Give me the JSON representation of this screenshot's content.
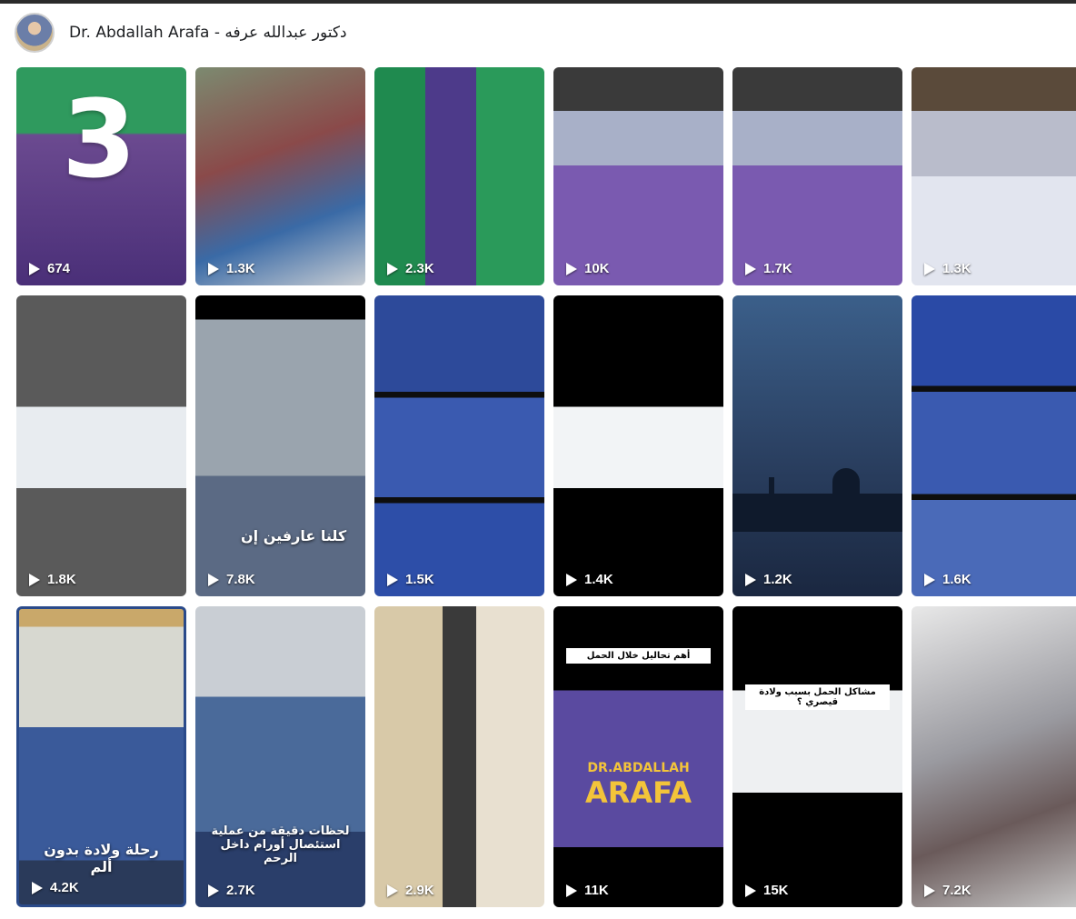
{
  "page": {
    "title": "Dr. Abdallah Arafa - دكتور عبدالله عرفه"
  },
  "icons": {
    "play": "play-icon",
    "avatar": "avatar"
  },
  "videos": [
    {
      "views": "674",
      "overlay": "3"
    },
    {
      "views": "1.3K"
    },
    {
      "views": "2.3K"
    },
    {
      "views": "10K"
    },
    {
      "views": "1.7K"
    },
    {
      "views": "1.3K"
    },
    {
      "views": "1.8K"
    },
    {
      "views": "7.8K",
      "overlay": "كلنا عارفين إن"
    },
    {
      "views": "1.5K"
    },
    {
      "views": "1.4K"
    },
    {
      "views": "1.2K"
    },
    {
      "views": "1.6K"
    },
    {
      "views": "4.2K",
      "overlay": "رحلة ولادة بدون ألم"
    },
    {
      "views": "2.7K",
      "overlay": "لحظات دقيقة من عملية استئصال أورام داخل الرحم"
    },
    {
      "views": "2.9K"
    },
    {
      "views": "11K",
      "label": "أهم تحاليل خلال الحمل",
      "brand_small": "DR.ABDALLAH",
      "brand_big": "ARAFA"
    },
    {
      "views": "15K",
      "label": "مشاكل الحمل بسبب ولادة قيصري ؟"
    },
    {
      "views": "7.2K"
    }
  ]
}
